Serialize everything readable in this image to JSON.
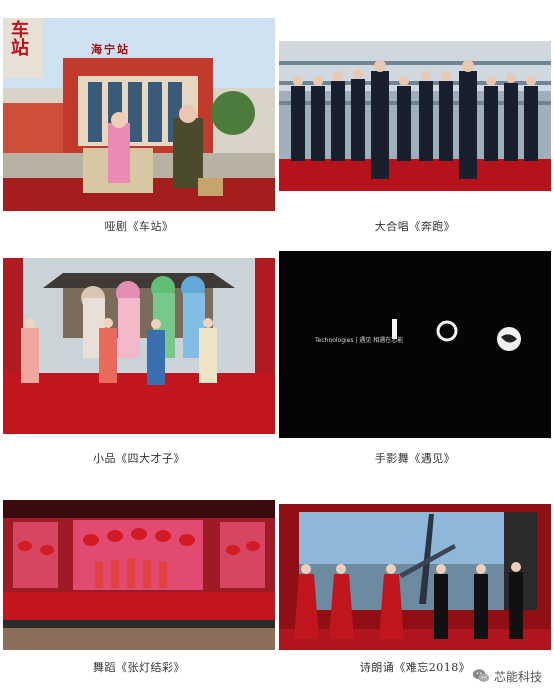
{
  "photos": [
    {
      "caption": "哑剧《车站》",
      "sign_text": "海宁站",
      "logo_text": "车站"
    },
    {
      "caption": "大合唱《奔跑》"
    },
    {
      "caption": "小品《四大才子》"
    },
    {
      "caption": "手影舞《遇见》",
      "screen_text": "Technologies | 遇见 相遇在芯能"
    },
    {
      "caption": "舞蹈《张灯结彩》"
    },
    {
      "caption": "诗朗诵《难忘2018》"
    }
  ],
  "watermark": {
    "text": "芯能科技",
    "icon": "wechat-icon"
  },
  "colors": {
    "stage_red": "#b5121b",
    "deep_red": "#8c0d12",
    "screen_dark": "#050507"
  }
}
